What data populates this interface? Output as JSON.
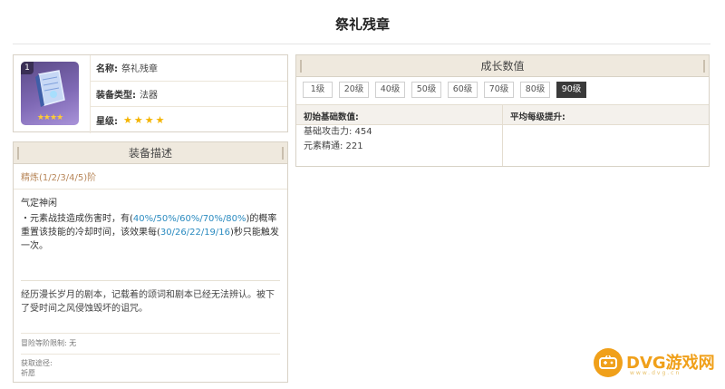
{
  "page": {
    "title": "祭礼残章"
  },
  "info": {
    "level_badge": "1",
    "name_key": "名称:",
    "name_val": "祭礼残章",
    "type_key": "装备类型:",
    "type_val": "法器",
    "rarity_key": "星级:",
    "rarity_stars": "★★★★",
    "rarity": 4
  },
  "description": {
    "header": "装备描述",
    "refinement": "精炼(1/2/3/4/5)阶",
    "passive_name": "气定神闲",
    "passive_p1": "・元素战技造成伤害时，有(",
    "passive_hl1": "40%/50%/60%/70%/80%",
    "passive_p2": ")的概率重置该技能的冷却时间，该效果每(",
    "passive_hl2": "30/26/22/19/16",
    "passive_p3": ")秒只能触发一次。",
    "lore": "经历漫长岁月的剧本，记载着的颂词和剧本已经无法辨认。被下了受时间之风侵蚀毁坏的诅咒。",
    "ascension_limit": "冒险等阶限制: 无",
    "source_label": "获取途径:",
    "source_value": "祈愿"
  },
  "growth": {
    "header": "成长数值",
    "levels": [
      "1级",
      "20级",
      "40级",
      "50级",
      "60级",
      "70级",
      "80级",
      "90级"
    ],
    "active_level": "90级",
    "base_header": "初始基础数值:",
    "per_level_header": "平均每级提升:",
    "atk_line": "基础攻击力: 454",
    "em_line": "元素精通: 221"
  },
  "watermark": {
    "brand": "DVG游戏网",
    "url": "www.dvg.cn"
  },
  "colors": {
    "highlight": "#2b8bc0",
    "refine": "#b8875a",
    "star": "#f4b400",
    "watermark": "#f0a01a"
  }
}
